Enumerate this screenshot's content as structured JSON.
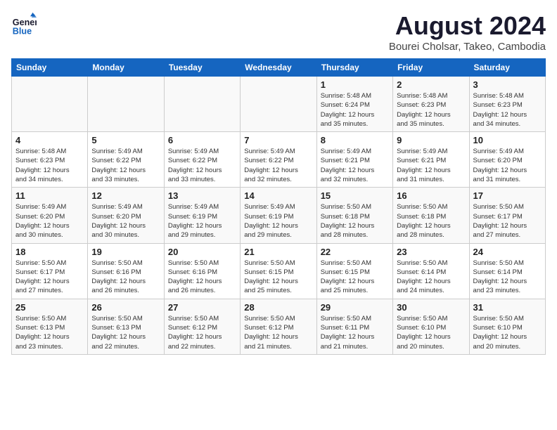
{
  "header": {
    "logo_line1": "General",
    "logo_line2": "Blue",
    "month_title": "August 2024",
    "subtitle": "Bourei Cholsar, Takeo, Cambodia"
  },
  "days_of_week": [
    "Sunday",
    "Monday",
    "Tuesday",
    "Wednesday",
    "Thursday",
    "Friday",
    "Saturday"
  ],
  "weeks": [
    [
      {
        "day": "",
        "info": ""
      },
      {
        "day": "",
        "info": ""
      },
      {
        "day": "",
        "info": ""
      },
      {
        "day": "",
        "info": ""
      },
      {
        "day": "1",
        "info": "Sunrise: 5:48 AM\nSunset: 6:24 PM\nDaylight: 12 hours\nand 35 minutes."
      },
      {
        "day": "2",
        "info": "Sunrise: 5:48 AM\nSunset: 6:23 PM\nDaylight: 12 hours\nand 35 minutes."
      },
      {
        "day": "3",
        "info": "Sunrise: 5:48 AM\nSunset: 6:23 PM\nDaylight: 12 hours\nand 34 minutes."
      }
    ],
    [
      {
        "day": "4",
        "info": "Sunrise: 5:48 AM\nSunset: 6:23 PM\nDaylight: 12 hours\nand 34 minutes."
      },
      {
        "day": "5",
        "info": "Sunrise: 5:49 AM\nSunset: 6:22 PM\nDaylight: 12 hours\nand 33 minutes."
      },
      {
        "day": "6",
        "info": "Sunrise: 5:49 AM\nSunset: 6:22 PM\nDaylight: 12 hours\nand 33 minutes."
      },
      {
        "day": "7",
        "info": "Sunrise: 5:49 AM\nSunset: 6:22 PM\nDaylight: 12 hours\nand 32 minutes."
      },
      {
        "day": "8",
        "info": "Sunrise: 5:49 AM\nSunset: 6:21 PM\nDaylight: 12 hours\nand 32 minutes."
      },
      {
        "day": "9",
        "info": "Sunrise: 5:49 AM\nSunset: 6:21 PM\nDaylight: 12 hours\nand 31 minutes."
      },
      {
        "day": "10",
        "info": "Sunrise: 5:49 AM\nSunset: 6:20 PM\nDaylight: 12 hours\nand 31 minutes."
      }
    ],
    [
      {
        "day": "11",
        "info": "Sunrise: 5:49 AM\nSunset: 6:20 PM\nDaylight: 12 hours\nand 30 minutes."
      },
      {
        "day": "12",
        "info": "Sunrise: 5:49 AM\nSunset: 6:20 PM\nDaylight: 12 hours\nand 30 minutes."
      },
      {
        "day": "13",
        "info": "Sunrise: 5:49 AM\nSunset: 6:19 PM\nDaylight: 12 hours\nand 29 minutes."
      },
      {
        "day": "14",
        "info": "Sunrise: 5:49 AM\nSunset: 6:19 PM\nDaylight: 12 hours\nand 29 minutes."
      },
      {
        "day": "15",
        "info": "Sunrise: 5:50 AM\nSunset: 6:18 PM\nDaylight: 12 hours\nand 28 minutes."
      },
      {
        "day": "16",
        "info": "Sunrise: 5:50 AM\nSunset: 6:18 PM\nDaylight: 12 hours\nand 28 minutes."
      },
      {
        "day": "17",
        "info": "Sunrise: 5:50 AM\nSunset: 6:17 PM\nDaylight: 12 hours\nand 27 minutes."
      }
    ],
    [
      {
        "day": "18",
        "info": "Sunrise: 5:50 AM\nSunset: 6:17 PM\nDaylight: 12 hours\nand 27 minutes."
      },
      {
        "day": "19",
        "info": "Sunrise: 5:50 AM\nSunset: 6:16 PM\nDaylight: 12 hours\nand 26 minutes."
      },
      {
        "day": "20",
        "info": "Sunrise: 5:50 AM\nSunset: 6:16 PM\nDaylight: 12 hours\nand 26 minutes."
      },
      {
        "day": "21",
        "info": "Sunrise: 5:50 AM\nSunset: 6:15 PM\nDaylight: 12 hours\nand 25 minutes."
      },
      {
        "day": "22",
        "info": "Sunrise: 5:50 AM\nSunset: 6:15 PM\nDaylight: 12 hours\nand 25 minutes."
      },
      {
        "day": "23",
        "info": "Sunrise: 5:50 AM\nSunset: 6:14 PM\nDaylight: 12 hours\nand 24 minutes."
      },
      {
        "day": "24",
        "info": "Sunrise: 5:50 AM\nSunset: 6:14 PM\nDaylight: 12 hours\nand 23 minutes."
      }
    ],
    [
      {
        "day": "25",
        "info": "Sunrise: 5:50 AM\nSunset: 6:13 PM\nDaylight: 12 hours\nand 23 minutes."
      },
      {
        "day": "26",
        "info": "Sunrise: 5:50 AM\nSunset: 6:13 PM\nDaylight: 12 hours\nand 22 minutes."
      },
      {
        "day": "27",
        "info": "Sunrise: 5:50 AM\nSunset: 6:12 PM\nDaylight: 12 hours\nand 22 minutes."
      },
      {
        "day": "28",
        "info": "Sunrise: 5:50 AM\nSunset: 6:12 PM\nDaylight: 12 hours\nand 21 minutes."
      },
      {
        "day": "29",
        "info": "Sunrise: 5:50 AM\nSunset: 6:11 PM\nDaylight: 12 hours\nand 21 minutes."
      },
      {
        "day": "30",
        "info": "Sunrise: 5:50 AM\nSunset: 6:10 PM\nDaylight: 12 hours\nand 20 minutes."
      },
      {
        "day": "31",
        "info": "Sunrise: 5:50 AM\nSunset: 6:10 PM\nDaylight: 12 hours\nand 20 minutes."
      }
    ]
  ]
}
